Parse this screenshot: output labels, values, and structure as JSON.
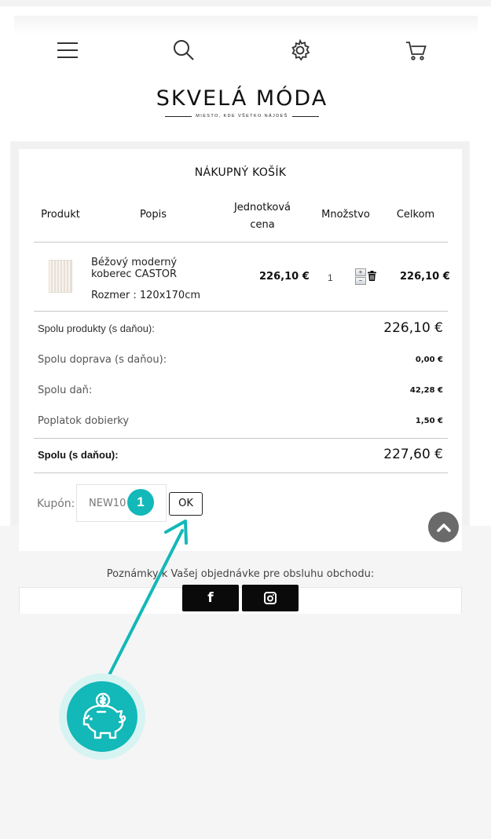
{
  "brand": {
    "name": "SKVELÁ MÓDA",
    "tagline": "MIESTO, KDE VŠETKO NÁJDEŠ"
  },
  "header_icons": [
    "menu-icon",
    "search-icon",
    "gear-icon",
    "cart-icon"
  ],
  "cart": {
    "title": "NÁKUPNÝ KOŠÍK",
    "columns": {
      "product": "Produkt",
      "description": "Popis",
      "unit_price_line1": "Jednotková",
      "unit_price_line2": "cena",
      "quantity": "Množstvo",
      "total": "Celkom"
    },
    "item": {
      "name": "Béžový moderný koberec CASTOR",
      "size": "Rozmer : 120x170cm",
      "unit_price": "226,10 €",
      "quantity": "1",
      "total": "226,10 €"
    },
    "summary": {
      "products_label": "Spolu produkty (s daňou):",
      "products_value": "226,10 €",
      "shipping_label": "Spolu doprava (s daňou):",
      "shipping_value": "0,00 €",
      "tax_label": "Spolu daň:",
      "tax_value": "42,28 €",
      "cod_label": "Poplatok dobierky",
      "cod_value": "1,50 €",
      "grand_label": "Spolu (s daňou):",
      "grand_value": "227,60 €"
    },
    "coupon": {
      "label": "Kupón:",
      "value": "NEW10",
      "button": "OK",
      "step_badge": "1"
    }
  },
  "notes": {
    "label": "Poznámky k Vašej objednávke pre obsluhu obchodu:"
  },
  "social": {
    "facebook": "f"
  },
  "colors": {
    "accent": "#13b8b8",
    "dark": "#0a0a0a",
    "scroll_button": "#6a6a6a"
  }
}
